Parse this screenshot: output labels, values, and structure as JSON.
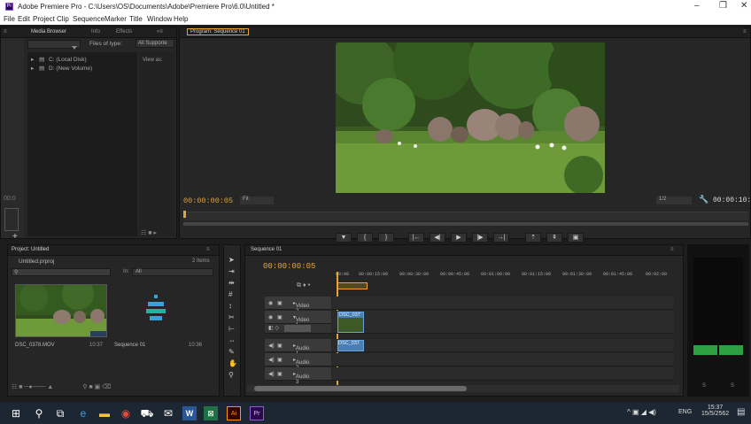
{
  "window": {
    "title": "Adobe Premiere Pro - C:\\Users\\OS\\Documents\\Adobe\\Premiere Pro\\6.0\\Untitled *",
    "app_icon": "Pr"
  },
  "menu": [
    "File",
    "Edit",
    "Project",
    "Clip",
    "Sequence",
    "Marker",
    "Title",
    "Window",
    "Help"
  ],
  "media_browser": {
    "tabs": [
      "Media Browser",
      "Info",
      "Effects"
    ],
    "files_of_type_label": "Files of type:",
    "files_of_type_value": "All Supporte",
    "view_as_label": "View as:",
    "drives": [
      "C: (Local Disk)",
      "D: (New Volume)"
    ],
    "left_timecode": "00:0"
  },
  "program_monitor": {
    "tab": "Program: Sequence 01",
    "current_time": "00:00:00:05",
    "fit_value": "Fit",
    "resolution_value": "1/2",
    "duration": "00:00:10:"
  },
  "project": {
    "tab": "Project: Untitled",
    "file_name": "Untitled.prproj",
    "item_count": "2 Items",
    "search_placeholder": "",
    "in_label": "In:",
    "in_value": "All",
    "items": [
      {
        "name": "DSC_0378.MOV",
        "duration": "10:37"
      },
      {
        "name": "Sequence 01",
        "duration": "10:36"
      }
    ]
  },
  "timeline": {
    "tab": "Sequence 01",
    "current_time": "00:00:00:05",
    "ruler_ticks": [
      "00:00",
      "00:00:15:00",
      "00:00:30:00",
      "00:00:45:00",
      "00:01:00:00",
      "00:01:15:00",
      "00:01:30:00",
      "00:01:45:00",
      "00:02:00"
    ],
    "tracks": [
      {
        "label": "Video 2"
      },
      {
        "label": "Video 1"
      },
      {
        "label": ""
      },
      {
        "label": "Audio 1"
      },
      {
        "label": "Audio 2"
      },
      {
        "label": "Audio 3"
      }
    ],
    "clip_video_label": "DSC_037",
    "clip_audio_label": "DSC_037"
  },
  "audio_meters": {
    "scale_left": "S",
    "scale_right": "S",
    "level": 0.1
  },
  "taskbar": {
    "clock_time": "15:37",
    "clock_date": "15/5/2562",
    "language": "ENG"
  },
  "colors": {
    "accent_orange": "#e8a23a",
    "clip_blue": "#4a7fb5",
    "meter_green": "#2ea043"
  }
}
